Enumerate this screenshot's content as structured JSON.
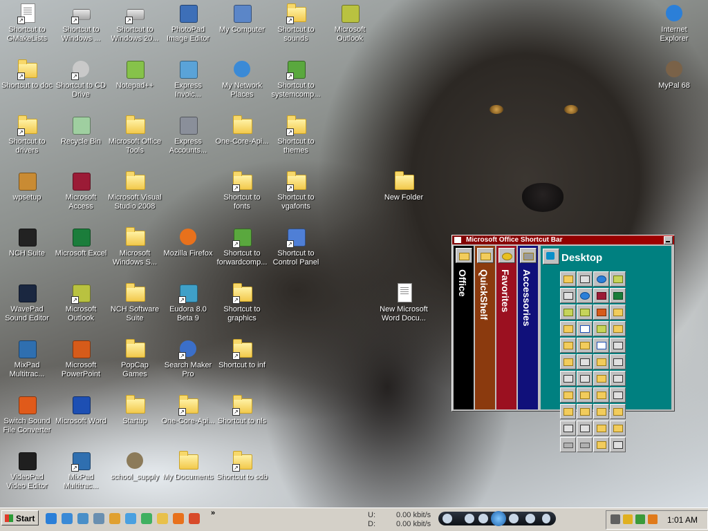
{
  "desktop_icons": [
    {
      "label": "Shortcut to GMakeLists",
      "icon": "text-document-icon",
      "kind": "doc",
      "shortcut": true
    },
    {
      "label": "Shortcut to Windows ...",
      "icon": "drive-icon",
      "kind": "drive",
      "shortcut": true
    },
    {
      "label": "Shortcut to Windows 20...",
      "icon": "drive-icon",
      "kind": "drive",
      "shortcut": true
    },
    {
      "label": "PhotoPad Image Editor",
      "icon": "photopad-icon",
      "kind": "box",
      "color": "#3d6fb8",
      "shortcut": false
    },
    {
      "label": "My Computer",
      "icon": "my-computer-icon",
      "kind": "box",
      "color": "#5b86c8",
      "shortcut": false
    },
    {
      "label": "Shortcut to sounds",
      "icon": "folder-icon",
      "kind": "folder",
      "shortcut": true
    },
    {
      "label": "Microsoft Outlook",
      "icon": "outlook-icon",
      "kind": "box",
      "color": "#b9c240",
      "shortcut": false
    },
    {
      "label": "Shortcut to doc",
      "icon": "folder-icon",
      "kind": "folder",
      "shortcut": true
    },
    {
      "label": "Shortcut to CD Drive",
      "icon": "cd-drive-icon",
      "kind": "round",
      "color": "#c9c9c9",
      "shortcut": true
    },
    {
      "label": "Notepad++",
      "icon": "notepad-plus-icon",
      "kind": "box",
      "color": "#86c24a",
      "shortcut": false
    },
    {
      "label": "Express Invoic...",
      "icon": "express-invoice-icon",
      "kind": "box",
      "color": "#5aa3d8",
      "shortcut": false
    },
    {
      "label": "My Network Places",
      "icon": "network-places-icon",
      "kind": "round",
      "color": "#3b8ad6",
      "shortcut": false
    },
    {
      "label": "Shortcut to systemcomp...",
      "icon": "component-icon",
      "kind": "box",
      "color": "#5aa83e",
      "shortcut": true
    },
    {
      "label": "Shortcut to drivers",
      "icon": "folder-icon",
      "kind": "folder",
      "shortcut": true
    },
    {
      "label": "Recycle Bin",
      "icon": "recycle-bin-icon",
      "kind": "box",
      "color": "#9fcfa0",
      "shortcut": false
    },
    {
      "label": "Microsoft Office Tools",
      "icon": "folder-icon",
      "kind": "folder",
      "shortcut": false
    },
    {
      "label": "Express Accounts...",
      "icon": "calculator-icon",
      "kind": "box",
      "color": "#8a8f9a",
      "shortcut": false
    },
    {
      "label": "One-Core-Api...",
      "icon": "folder-icon",
      "kind": "folder",
      "shortcut": false
    },
    {
      "label": "Shortcut to themes",
      "icon": "folder-icon",
      "kind": "folder",
      "shortcut": true
    },
    {
      "label": "wpsetup",
      "icon": "setup-icon",
      "kind": "box",
      "color": "#c98b33",
      "shortcut": false
    },
    {
      "label": "Microsoft Access",
      "icon": "access-icon",
      "kind": "box",
      "color": "#9b1b36",
      "shortcut": false
    },
    {
      "label": "Microsoft Visual Studio 2008",
      "icon": "folder-icon",
      "kind": "folder",
      "shortcut": false
    },
    {
      "label": "Shortcut to fonts",
      "icon": "folder-icon",
      "kind": "folder",
      "shortcut": true
    },
    {
      "label": "Shortcut to vgafonts",
      "icon": "folder-icon",
      "kind": "folder",
      "shortcut": true
    },
    {
      "label": "New Folder",
      "icon": "folder-icon",
      "kind": "folder",
      "shortcut": false
    },
    {
      "label": "NCH Suite",
      "icon": "nch-suite-icon",
      "kind": "box",
      "color": "#222222",
      "shortcut": false
    },
    {
      "label": "Microsoft Excel",
      "icon": "excel-icon",
      "kind": "box",
      "color": "#1b7d3b",
      "shortcut": false
    },
    {
      "label": "Microsoft Windows S...",
      "icon": "folder-icon",
      "kind": "folder",
      "shortcut": false
    },
    {
      "label": "Mozilla Firefox",
      "icon": "firefox-icon",
      "kind": "round",
      "color": "#e8711c",
      "shortcut": false
    },
    {
      "label": "Shortcut to forwardcomp...",
      "icon": "component-icon",
      "kind": "box",
      "color": "#5aa83e",
      "shortcut": true
    },
    {
      "label": "Shortcut to Control Panel",
      "icon": "control-panel-icon",
      "kind": "box",
      "color": "#4f7fd6",
      "shortcut": true
    },
    {
      "label": "WavePad Sound Editor",
      "icon": "wavepad-icon",
      "kind": "box",
      "color": "#1a2740",
      "shortcut": false
    },
    {
      "label": "Microsoft Outlook",
      "icon": "outlook-icon",
      "kind": "box",
      "color": "#b9c240",
      "shortcut": true
    },
    {
      "label": "NCH Software Suite",
      "icon": "folder-icon",
      "kind": "folder",
      "shortcut": false
    },
    {
      "label": "Eudora 8.0 Beta 9",
      "icon": "eudora-icon",
      "kind": "box",
      "color": "#3fa0c8",
      "shortcut": true
    },
    {
      "label": "Shortcut to graphics",
      "icon": "folder-icon",
      "kind": "folder",
      "shortcut": true
    },
    {
      "label": "New Microsoft Word Docu...",
      "icon": "word-document-icon",
      "kind": "doc",
      "shortcut": false
    },
    {
      "label": "MixPad Multitrac...",
      "icon": "mixpad-icon",
      "kind": "box",
      "color": "#2f6fb0",
      "shortcut": false
    },
    {
      "label": "Microsoft PowerPoint",
      "icon": "powerpoint-icon",
      "kind": "box",
      "color": "#d65b1a",
      "shortcut": false
    },
    {
      "label": "PopCap Games",
      "icon": "folder-icon",
      "kind": "folder",
      "shortcut": false
    },
    {
      "label": "Search Maker Pro",
      "icon": "search-maker-icon",
      "kind": "round",
      "color": "#3b6fc9",
      "shortcut": true
    },
    {
      "label": "Shortcut to inf",
      "icon": "folder-icon",
      "kind": "folder",
      "shortcut": true
    },
    {
      "label": "Switch Sound File Converter",
      "icon": "switch-icon",
      "kind": "box",
      "color": "#e05a1a",
      "shortcut": false
    },
    {
      "label": "Microsoft Word",
      "icon": "word-icon",
      "kind": "box",
      "color": "#1d4fb3",
      "shortcut": false
    },
    {
      "label": "Startup",
      "icon": "folder-icon",
      "kind": "folder",
      "shortcut": false
    },
    {
      "label": "One-Core-Api...",
      "icon": "zip-folder-icon",
      "kind": "folder",
      "shortcut": true
    },
    {
      "label": "Shortcut to nls",
      "icon": "folder-icon",
      "kind": "folder",
      "shortcut": true
    },
    {
      "label": "VideoPad Video Editor",
      "icon": "videopad-icon",
      "kind": "box",
      "color": "#1f1f1f",
      "shortcut": false
    },
    {
      "label": "MixPad Multitrac...",
      "icon": "mixpad-icon",
      "kind": "box",
      "color": "#2f6fb0",
      "shortcut": true
    },
    {
      "label": "school_supply",
      "icon": "animal-icon",
      "kind": "round",
      "color": "#8c7b5a",
      "shortcut": false
    },
    {
      "label": "My Documents",
      "icon": "my-documents-icon",
      "kind": "folder",
      "shortcut": false
    },
    {
      "label": "Shortcut to sdb",
      "icon": "folder-icon",
      "kind": "folder",
      "shortcut": true
    },
    {
      "label": "Internet Explorer",
      "icon": "internet-explorer-icon",
      "kind": "round",
      "color": "#2b7fd8",
      "shortcut": false
    },
    {
      "label": "MyPal 68",
      "icon": "mypal-icon",
      "kind": "round",
      "color": "#7a6248",
      "shortcut": false
    }
  ],
  "shortcut_bar": {
    "title": "Microsoft Office Shortcut Bar",
    "tabs": [
      {
        "label": "Office",
        "color": "#000000"
      },
      {
        "label": "QuickShelf",
        "color": "#8b3a0e"
      },
      {
        "label": "Favorites",
        "color": "#9b1020"
      },
      {
        "label": "Accessories",
        "color": "#10107a"
      }
    ],
    "active_panel": "Desktop",
    "panel_color": "#008080",
    "buttons": [
      "drive",
      "app",
      "ie",
      "out",
      "app",
      "ie",
      "acc",
      "xl",
      "out",
      "out",
      "pp",
      "folder",
      "folder",
      "word",
      "out",
      "folder",
      "folder",
      "folder",
      "word",
      "app",
      "folder",
      "app",
      "folder",
      "app",
      "app",
      "app",
      "folder",
      "app",
      "folder",
      "folder",
      "folder",
      "app",
      "folder",
      "folder",
      "folder",
      "folder",
      "app",
      "app",
      "folder",
      "folder",
      "dr",
      "dr",
      "folder",
      "app"
    ]
  },
  "taskbar": {
    "start_label": "Start",
    "quick_launch": [
      {
        "icon": "ie-icon",
        "color": "#2b7fd8"
      },
      {
        "icon": "ie-icon",
        "color": "#3b8ad6"
      },
      {
        "icon": "network-icon",
        "color": "#4a8fc8"
      },
      {
        "icon": "desktop-icon",
        "color": "#6a8fb0"
      },
      {
        "icon": "outlook-express-icon",
        "color": "#e0a030"
      },
      {
        "icon": "window-icon",
        "color": "#4aa0e0"
      },
      {
        "icon": "messenger-icon",
        "color": "#40b060"
      },
      {
        "icon": "folder-icon",
        "color": "#e8c04a"
      },
      {
        "icon": "firefox-icon",
        "color": "#e8711c"
      },
      {
        "icon": "mail-icon",
        "color": "#d84a2a"
      }
    ],
    "more": "»",
    "net_upload_label": "U:",
    "net_upload_value": "0.00 kbit/s",
    "net_download_label": "D:",
    "net_download_value": "0.00 kbit/s",
    "tray_icons": [
      {
        "icon": "calculator-icon",
        "color": "#606060"
      },
      {
        "icon": "shield-icon",
        "color": "#e0b020"
      },
      {
        "icon": "users-icon",
        "color": "#3a9a3a"
      },
      {
        "icon": "search-icon",
        "color": "#e07a1a"
      }
    ],
    "clock": "1:01 AM"
  }
}
